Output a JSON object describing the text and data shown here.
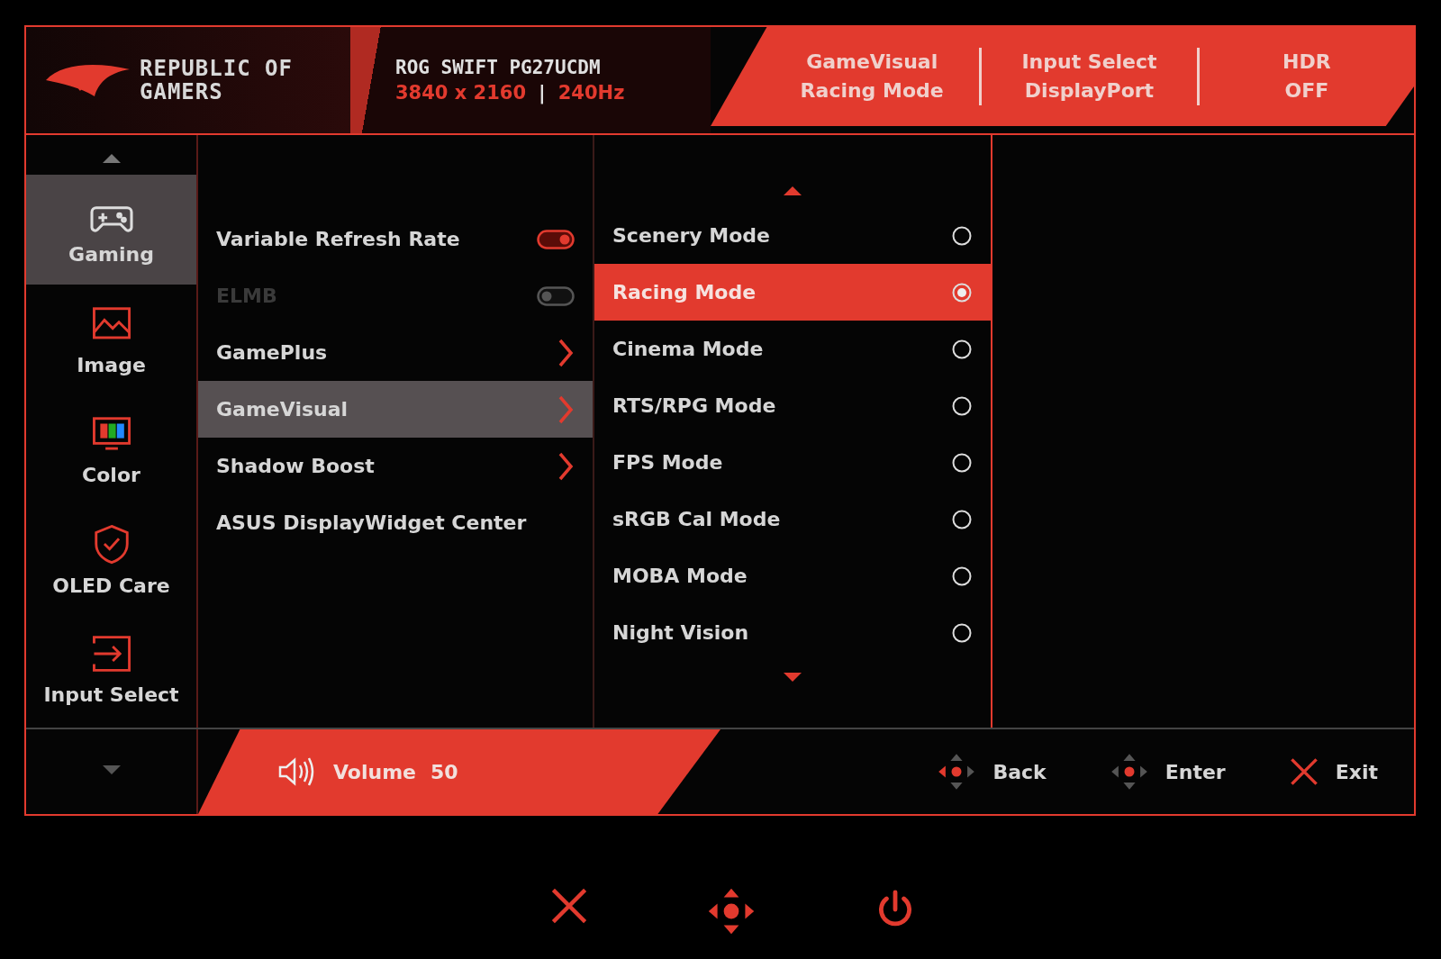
{
  "header": {
    "brand": [
      "REPUBLIC OF",
      "GAMERS"
    ],
    "model": "ROG SWIFT PG27UCDM",
    "resolution": "3840 x 2160",
    "separator": "|",
    "refresh": "240Hz",
    "status": [
      {
        "label": "GameVisual",
        "value": "Racing Mode"
      },
      {
        "label": "Input Select",
        "value": "DisplayPort"
      },
      {
        "label": "HDR",
        "value": "OFF"
      }
    ]
  },
  "sidebar": {
    "items": [
      {
        "label": "Gaming",
        "kind": "gamepad",
        "selected": true
      },
      {
        "label": "Image",
        "kind": "image",
        "selected": false
      },
      {
        "label": "Color",
        "kind": "color",
        "selected": false
      },
      {
        "label": "OLED Care",
        "kind": "shield",
        "selected": false
      },
      {
        "label": "Input Select",
        "kind": "input",
        "selected": false
      }
    ]
  },
  "menu": {
    "items": [
      {
        "label": "Variable Refresh Rate",
        "kind": "toggle",
        "on": true,
        "disabled": false,
        "selected": false
      },
      {
        "label": "ELMB",
        "kind": "toggle",
        "on": false,
        "disabled": true,
        "selected": false
      },
      {
        "label": "GamePlus",
        "kind": "submenu",
        "disabled": false,
        "selected": false
      },
      {
        "label": "GameVisual",
        "kind": "submenu",
        "disabled": false,
        "selected": true
      },
      {
        "label": "Shadow Boost",
        "kind": "submenu",
        "disabled": false,
        "selected": false
      },
      {
        "label": "ASUS DisplayWidget Center",
        "kind": "plain",
        "disabled": false,
        "selected": false
      }
    ]
  },
  "options": {
    "items": [
      {
        "label": "Scenery Mode",
        "selected": false
      },
      {
        "label": "Racing Mode",
        "selected": true
      },
      {
        "label": "Cinema Mode",
        "selected": false
      },
      {
        "label": "RTS/RPG Mode",
        "selected": false
      },
      {
        "label": "FPS Mode",
        "selected": false
      },
      {
        "label": "sRGB Cal Mode",
        "selected": false
      },
      {
        "label": "MOBA Mode",
        "selected": false
      },
      {
        "label": "Night Vision",
        "selected": false
      }
    ]
  },
  "footer": {
    "volume": {
      "label": "Volume",
      "value": "50"
    },
    "nav": [
      {
        "label": "Back",
        "kind": "dpad-left"
      },
      {
        "label": "Enter",
        "kind": "dpad-center"
      },
      {
        "label": "Exit",
        "kind": "close"
      }
    ]
  },
  "bezel_buttons": [
    {
      "kind": "close"
    },
    {
      "kind": "dpad"
    },
    {
      "kind": "power"
    }
  ]
}
